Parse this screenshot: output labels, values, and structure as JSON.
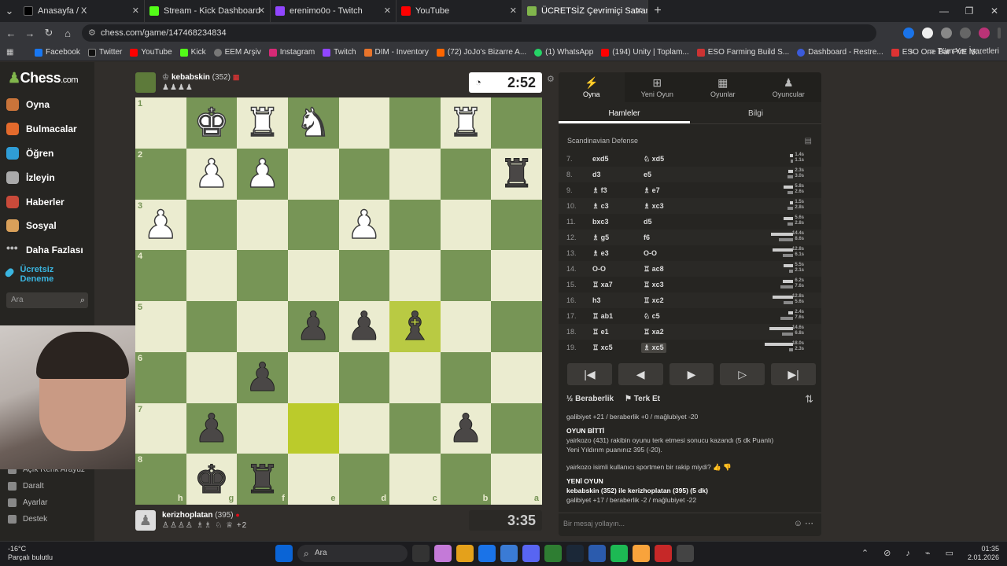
{
  "browser": {
    "tabs": [
      {
        "title": "Anasayfa / X",
        "color": "#000000"
      },
      {
        "title": "Stream - Kick Dashboard",
        "color": "#53fc18"
      },
      {
        "title": "erenimo0o - Twitch",
        "color": "#9146ff"
      },
      {
        "title": "YouTube",
        "color": "#ff0000"
      },
      {
        "title": "ÜCRETSİZ Çevrimiçi Satranç Oy",
        "color": "#81b64c"
      }
    ],
    "url": "chess.com/game/147468234834",
    "bookmarks": [
      "Facebook",
      "Twitter",
      "YouTube",
      "Kick",
      "EEM Arşiv",
      "Instagram",
      "Twitch",
      "DIM - Inventory",
      "(72) JoJo's Bizarre A...",
      "(1) WhatsApp",
      "(194) Unity | Toplam...",
      "ESO Farming Build S...",
      "Dashboard - Restre...",
      "ESO One Bar PvE M..."
    ],
    "bookmarks_right": "Tüm Yer İşaretleri"
  },
  "sidebar": {
    "logo": "Chess",
    "logo_suffix": ".com",
    "items": [
      "Oyna",
      "Bulmacalar",
      "Öğren",
      "İzleyin",
      "Haberler",
      "Sosyal",
      "Daha Fazlası",
      "Ücretsiz Deneme"
    ],
    "search_placeholder": "Ara",
    "bottom_items": [
      "Açık Renk Arayüz",
      "Daralt",
      "Ayarlar",
      "Destek"
    ]
  },
  "top_player": {
    "name": "kebabskin",
    "rating": "(352)",
    "clock": "2:52",
    "captured": "♟♟♟♟"
  },
  "bottom_player": {
    "name": "kerizhoplatan",
    "rating": "(395)",
    "clock": "3:35",
    "captured": "♙♙♙♙ ♗♗ ♘ ♕",
    "advantage": "+2"
  },
  "board": {
    "ranks": [
      "1",
      "2",
      "3",
      "4",
      "5",
      "6",
      "7",
      "8"
    ],
    "files": [
      "h",
      "g",
      "f",
      "e",
      "d",
      "c",
      "b",
      "a"
    ],
    "squares": [
      [
        "",
        "♚w",
        "♜w",
        "♞w",
        "",
        "",
        "♜w",
        ""
      ],
      [
        "",
        "♟w",
        "♟w",
        "",
        "",
        "",
        "",
        "♜b"
      ],
      [
        "♟w",
        "",
        "",
        "",
        "♟w",
        "",
        "",
        ""
      ],
      [
        "",
        "",
        "",
        "",
        "",
        "",
        "",
        ""
      ],
      [
        "",
        "",
        "",
        "♟b",
        "♟b",
        "♝b",
        "",
        ""
      ],
      [
        "",
        "",
        "♟b",
        "",
        "",
        "",
        "",
        ""
      ],
      [
        "",
        "♟b",
        "",
        "",
        "",
        "",
        "♟b",
        ""
      ],
      [
        "",
        "♚b",
        "♜b",
        "",
        "",
        "",
        "",
        ""
      ]
    ]
  },
  "panel": {
    "tabs": [
      "Oyna",
      "Yeni Oyun",
      "Oyunlar",
      "Oyuncular"
    ],
    "subtabs": [
      "Hamleler",
      "Bilgi"
    ],
    "opening": "Scandinavian Defense",
    "moves": [
      {
        "n": "7.",
        "w": "exd5",
        "b": "♘ xd5",
        "tw": "1.4s",
        "tb": "1.1s",
        "ww": 4,
        "wb": 3
      },
      {
        "n": "8.",
        "w": "d3",
        "b": "e5",
        "tw": "2.3s",
        "tb": "3.0s",
        "ww": 6,
        "wb": 7
      },
      {
        "n": "9.",
        "w": "♗ f3",
        "b": "♗ e7",
        "tw": "5.8s",
        "tb": "2.6s",
        "ww": 12,
        "wb": 7
      },
      {
        "n": "10.",
        "w": "♗ c3",
        "b": "♗ xc3",
        "tw": "1.5s",
        "tb": "2.8s",
        "ww": 4,
        "wb": 7
      },
      {
        "n": "11.",
        "w": "bxc3",
        "b": "d5",
        "tw": "5.6s",
        "tb": "2.8s",
        "ww": 12,
        "wb": 7
      },
      {
        "n": "12.",
        "w": "♗ g5",
        "b": "f6",
        "tw": "14.4s",
        "tb": "8.6s",
        "ww": 28,
        "wb": 18
      },
      {
        "n": "13.",
        "w": "♗ e3",
        "b": "O-O",
        "tw": "12.8s",
        "tb": "6.1s",
        "ww": 26,
        "wb": 13
      },
      {
        "n": "14.",
        "w": "O-O",
        "b": "♖ ac8",
        "tw": "5.5s",
        "tb": "2.1s",
        "ww": 12,
        "wb": 5
      },
      {
        "n": "15.",
        "w": "♖ xa7",
        "b": "♖ xc3",
        "tw": "6.2s",
        "tb": "7.6s",
        "ww": 13,
        "wb": 16
      },
      {
        "n": "16.",
        "w": "h3",
        "b": "♖ xc2",
        "tw": "12.8s",
        "tb": "5.6s",
        "ww": 26,
        "wb": 12
      },
      {
        "n": "17.",
        "w": "♖ ab1",
        "b": "♘ c5",
        "tw": "2.4s",
        "tb": "7.6s",
        "ww": 6,
        "wb": 16
      },
      {
        "n": "18.",
        "w": "♖ e1",
        "b": "♖ xa2",
        "tw": "14.6s",
        "tb": "6.8s",
        "ww": 30,
        "wb": 14
      },
      {
        "n": "19.",
        "w": "♖ xc5",
        "b": "♗ xc5",
        "tw": "18.0s",
        "tb": "2.3s",
        "ww": 36,
        "wb": 5
      }
    ],
    "draw_label": "Beraberlik",
    "resign_label": "Terk Et",
    "chat": [
      {
        "t": "galibiyet +21 / beraberlik +0 / mağlubiyet -20",
        "s": "n"
      },
      {
        "t": "OYUN BİTTİ",
        "s": "h"
      },
      {
        "t": "yairkozo (431) rakibin oyunu terk etmesi sonucu kazandı (5 dk Puanlı)",
        "s": "n"
      },
      {
        "t": "Yeni Yıldırım puanınız 395 (-20).",
        "s": "n"
      },
      {
        "t": "yairkozo isimli kullanıcı sportmen bir rakip miydi?",
        "s": "n"
      },
      {
        "t": "YENİ OYUN",
        "s": "h"
      },
      {
        "t": "kebabskin (352) ile kerizhoplatan (395) (5 dk)",
        "s": "b"
      },
      {
        "t": "galibiyet +17 / beraberlik -2 / mağlubiyet -22",
        "s": "n"
      }
    ],
    "chat_placeholder": "Bir mesaj yollayın..."
  },
  "taskbar": {
    "weather_temp": "-16°C",
    "weather_desc": "Parçalı bulutlu",
    "search": "Ara",
    "time": "01:35",
    "date": "2.01.2026"
  }
}
